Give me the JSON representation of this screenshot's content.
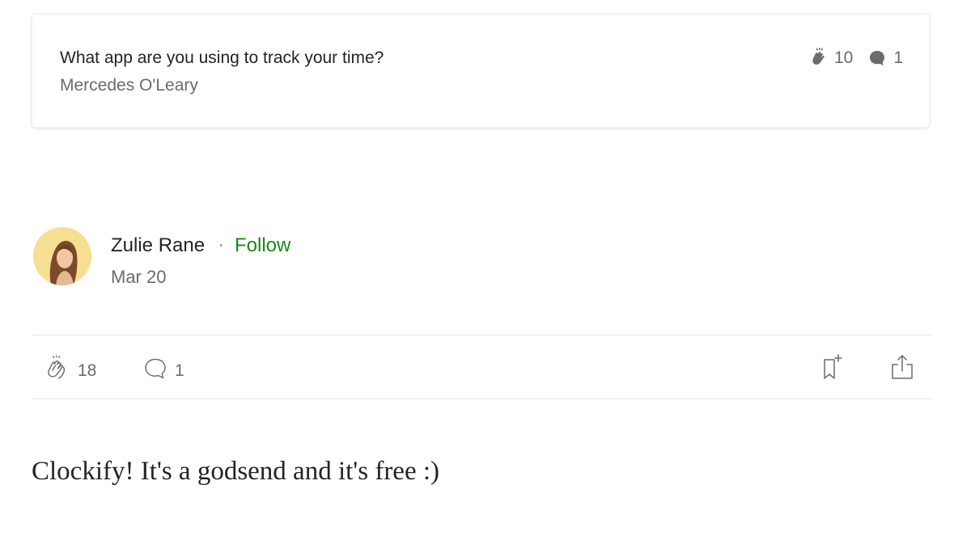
{
  "quoted_response": {
    "title": "What app are you using to track your time?",
    "author": "Mercedes O'Leary",
    "claps": "10",
    "comments": "1",
    "clap_icon": "clap-icon",
    "comment_icon": "comment-filled-icon"
  },
  "author": {
    "name": "Zulie Rane",
    "separator": "·",
    "follow_label": "Follow",
    "date": "Mar 20",
    "avatar": "avatar-photo"
  },
  "actions": {
    "claps": "18",
    "comments": "1",
    "clap_icon": "clap-outline-icon",
    "comment_icon": "comment-outline-icon",
    "bookmark_icon": "bookmark-add-icon",
    "share_icon": "share-icon"
  },
  "response": {
    "text": "Clockify! It's a godsend and it's free :)"
  },
  "colors": {
    "follow": "#1a8917",
    "text": "#242424",
    "muted": "#6b6b6b"
  }
}
